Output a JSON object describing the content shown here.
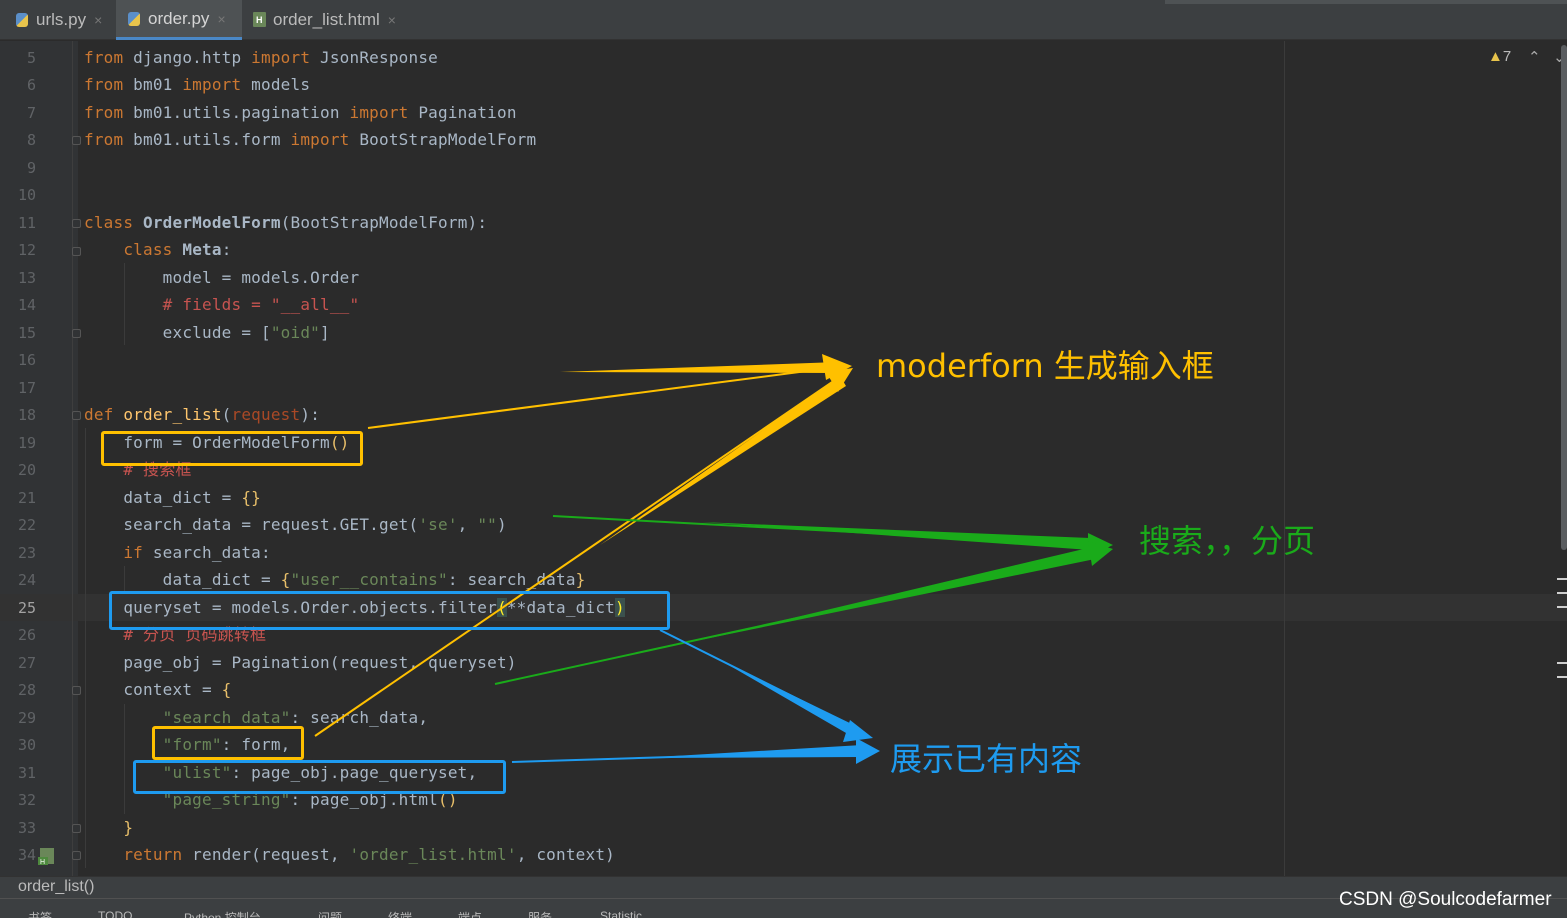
{
  "tabs": [
    {
      "label": "urls.py",
      "icon": "python-file-icon",
      "active": false
    },
    {
      "label": "order.py",
      "icon": "python-file-icon",
      "active": true
    },
    {
      "label": "order_list.html",
      "icon": "html-file-icon",
      "active": false
    }
  ],
  "close_glyph": "×",
  "editor": {
    "current_line": 25,
    "line_numbers": [
      "5",
      "6",
      "7",
      "8",
      "9",
      "10",
      "11",
      "12",
      "13",
      "14",
      "15",
      "16",
      "17",
      "18",
      "19",
      "20",
      "21",
      "22",
      "23",
      "24",
      "25",
      "26",
      "27",
      "28",
      "29",
      "30",
      "31",
      "32",
      "33",
      "34"
    ],
    "lines": [
      "from django.http import JsonResponse",
      "from bm01 import models",
      "from bm01.utils.pagination import Pagination",
      "from bm01.utils.form import BootStrapModelForm",
      "",
      "",
      "class OrderModelForm(BootStrapModelForm):",
      "    class Meta:",
      "        model = models.Order",
      "        # fields = \"__all__\"",
      "        exclude = [\"oid\"]",
      "",
      "",
      "def order_list(request):",
      "    form = OrderModelForm()",
      "    # 搜索框",
      "    data_dict = {}",
      "    search_data = request.GET.get('se', \"\")",
      "    if search_data:",
      "        data_dict = {\"user__contains\": search_data}",
      "    queryset = models.Order.objects.filter(**data_dict)",
      "    # 分页 页码跳转框",
      "    page_obj = Pagination(request, queryset)",
      "    context = {",
      "        \"search_data\": search_data,",
      "        \"form\": form,",
      "        \"ulist\": page_obj.page_queryset,",
      "        \"page_string\": page_obj.html()",
      "    }",
      "    return render(request, 'order_list.html', context)"
    ]
  },
  "inspection": {
    "warning_count": "7"
  },
  "breadcrumb": "order_list()",
  "status_bar": [
    "书签",
    "TODO",
    "Python 控制台",
    "问题",
    "终端",
    "端点",
    "服务",
    "Statistic"
  ],
  "annotations": [
    {
      "text": "moderforn 生成输入框",
      "color": "#ffc000"
    },
    {
      "text": "搜索，，分页",
      "color": "#1aab1a"
    },
    {
      "text": "展示已有内容",
      "color": "#1e9bf0"
    }
  ],
  "watermark": "CSDN @Soulcodefarmer"
}
